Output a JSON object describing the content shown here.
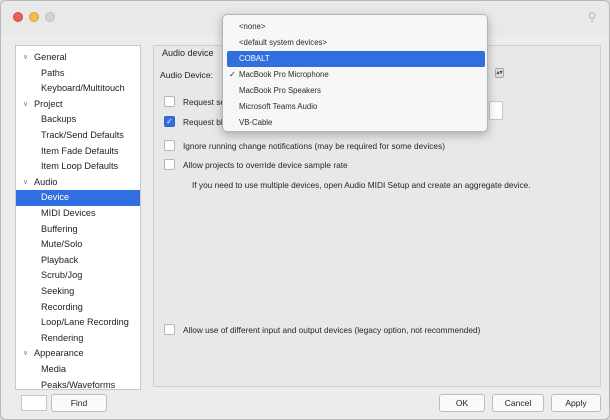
{
  "sidebar": {
    "items": [
      {
        "label": "General",
        "level": 0,
        "expandable": true
      },
      {
        "label": "Paths",
        "level": 1
      },
      {
        "label": "Keyboard/Multitouch",
        "level": 1
      },
      {
        "label": "Project",
        "level": 0,
        "expandable": true
      },
      {
        "label": "Backups",
        "level": 1
      },
      {
        "label": "Track/Send Defaults",
        "level": 1
      },
      {
        "label": "Item Fade Defaults",
        "level": 1
      },
      {
        "label": "Item Loop Defaults",
        "level": 1
      },
      {
        "label": "Audio",
        "level": 0,
        "expandable": true
      },
      {
        "label": "Device",
        "level": 1,
        "selected": true
      },
      {
        "label": "MIDI Devices",
        "level": 1
      },
      {
        "label": "Buffering",
        "level": 1
      },
      {
        "label": "Mute/Solo",
        "level": 1
      },
      {
        "label": "Playback",
        "level": 1
      },
      {
        "label": "Scrub/Jog",
        "level": 1
      },
      {
        "label": "Seeking",
        "level": 1
      },
      {
        "label": "Recording",
        "level": 1
      },
      {
        "label": "Loop/Lane Recording",
        "level": 1
      },
      {
        "label": "Rendering",
        "level": 1
      },
      {
        "label": "Appearance",
        "level": 0,
        "expandable": true
      },
      {
        "label": "Media",
        "level": 1
      },
      {
        "label": "Peaks/Waveforms",
        "level": 1
      }
    ]
  },
  "content": {
    "section_label": "Audio device",
    "device_label": "Audio Device:",
    "checkboxes": [
      {
        "label": "Request se",
        "checked": false
      },
      {
        "label": "Request bl",
        "checked": true
      },
      {
        "label": "Ignore running change notifications (may be required for some devices)",
        "checked": false
      },
      {
        "label": "Allow projects to override device sample rate",
        "checked": false
      },
      {
        "label": "Allow use of different input and output devices (legacy option, not recommended)",
        "checked": false
      }
    ],
    "info_text": "If you need to use multiple devices, open Audio MIDI Setup and create an aggregate device."
  },
  "dropdown": {
    "options": [
      {
        "label": "<none>"
      },
      {
        "label": "<default system devices>"
      },
      {
        "label": "COBALT",
        "highlighted": true
      },
      {
        "label": "MacBook Pro Microphone",
        "checked": true
      },
      {
        "label": "MacBook Pro Speakers"
      },
      {
        "label": "Microsoft Teams Audio"
      },
      {
        "label": "VB-Cable"
      }
    ]
  },
  "footer": {
    "find_label": "Find",
    "ok_label": "OK",
    "cancel_label": "Cancel",
    "apply_label": "Apply"
  },
  "colors": {
    "selection": "#2f6fe0",
    "close": "#ec5f57",
    "minimize": "#f4bd4f"
  }
}
